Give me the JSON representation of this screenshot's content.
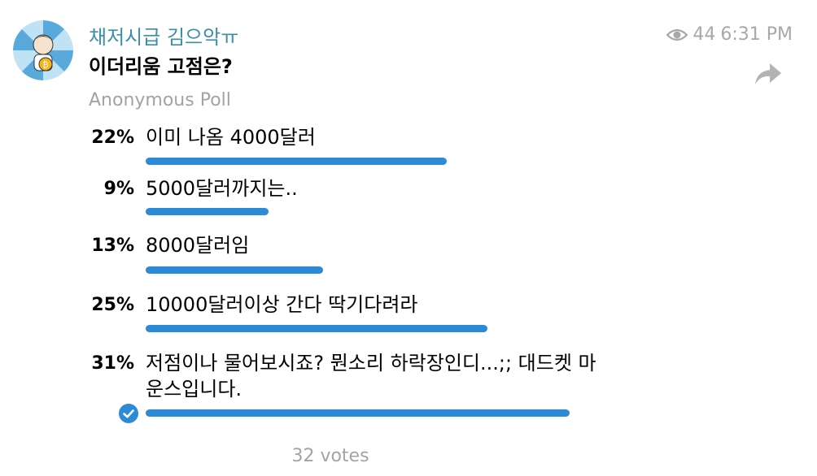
{
  "message": {
    "sender": "채저시급 김으악ㅠ",
    "question": "이더리움 고점은?",
    "views": "44",
    "time": "6:31 PM"
  },
  "poll": {
    "type_label": "Anonymous Poll",
    "options": [
      {
        "percent": "22%",
        "text": "이미 나옴 4000달러",
        "value": 0.22
      },
      {
        "percent": "9%",
        "text": "5000달러까지는..",
        "value": 0.09
      },
      {
        "percent": "13%",
        "text": "8000달러임",
        "value": 0.13
      },
      {
        "percent": "25%",
        "text": "10000달러이상 간다 딱기다려라",
        "value": 0.25
      },
      {
        "percent": "31%",
        "text": "저점이나 물어보시죠? 뭔소리 하락장인디...;; 대드켓 마운스입니다.",
        "value": 0.31,
        "selected": true
      }
    ],
    "votes": "32 votes"
  },
  "colors": {
    "accent": "#2b8bd6",
    "sender": "#3a8fa8",
    "muted": "#a3a3a3"
  },
  "icons": [
    "avatar",
    "eye-icon",
    "share-icon",
    "check-icon"
  ]
}
